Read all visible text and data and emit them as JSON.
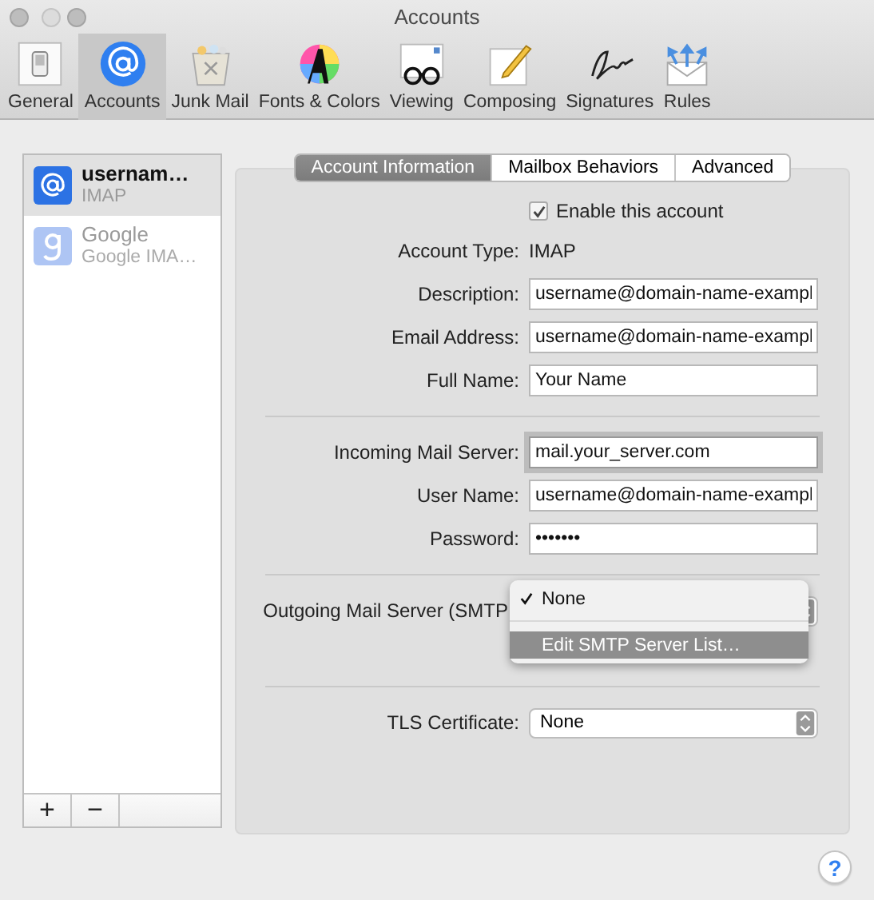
{
  "window": {
    "title": "Accounts"
  },
  "toolbar": [
    {
      "label": "General",
      "kind": "general",
      "selected": false
    },
    {
      "label": "Accounts",
      "kind": "accounts",
      "selected": true
    },
    {
      "label": "Junk Mail",
      "kind": "junk",
      "selected": false
    },
    {
      "label": "Fonts & Colors",
      "kind": "fonts",
      "selected": false
    },
    {
      "label": "Viewing",
      "kind": "viewing",
      "selected": false
    },
    {
      "label": "Composing",
      "kind": "composing",
      "selected": false
    },
    {
      "label": "Signatures",
      "kind": "signatures",
      "selected": false
    },
    {
      "label": "Rules",
      "kind": "rules",
      "selected": false
    }
  ],
  "accounts": [
    {
      "name": "usernam…",
      "type": "IMAP",
      "kind": "imap",
      "selected": true,
      "disabled": false
    },
    {
      "name": "Google",
      "type": "Google IMA…",
      "kind": "google",
      "selected": false,
      "disabled": true
    }
  ],
  "list_buttons": [
    "+",
    "−"
  ],
  "tabs": [
    {
      "label": "Account Information",
      "selected": true
    },
    {
      "label": "Mailbox Behaviors",
      "selected": false
    },
    {
      "label": "Advanced",
      "selected": false
    }
  ],
  "sections": [
    [
      {
        "kind": "checkbox",
        "label": "Enable this account",
        "checked": true
      },
      {
        "kind": "static",
        "label": "Account Type:",
        "value": "IMAP"
      },
      {
        "kind": "text",
        "label": "Description:",
        "value": "username@domain-name-exampl",
        "focused": false
      },
      {
        "kind": "text",
        "label": "Email Address:",
        "value": "username@domain-name-exampl",
        "focused": false
      },
      {
        "kind": "text",
        "label": "Full Name:",
        "value": "Your Name",
        "focused": false
      }
    ],
    [
      {
        "kind": "text",
        "label": "Incoming Mail Server:",
        "value": "mail.your_server.com",
        "focused": true
      },
      {
        "kind": "text",
        "label": "User Name:",
        "value": "username@domain-name-exampl",
        "focused": false
      },
      {
        "kind": "password",
        "label": "Password:",
        "value": "•••••••"
      }
    ],
    [
      {
        "kind": "menu",
        "label": "Outgoing Mail Server (SMTP",
        "items": [
          {
            "label": "None",
            "checked": true,
            "selected": false
          },
          {
            "label": "Edit SMTP Server List…",
            "checked": false,
            "selected": true
          }
        ]
      }
    ],
    [
      {
        "kind": "popup",
        "label": "TLS Certificate:",
        "value": "None"
      }
    ]
  ],
  "help": "?"
}
